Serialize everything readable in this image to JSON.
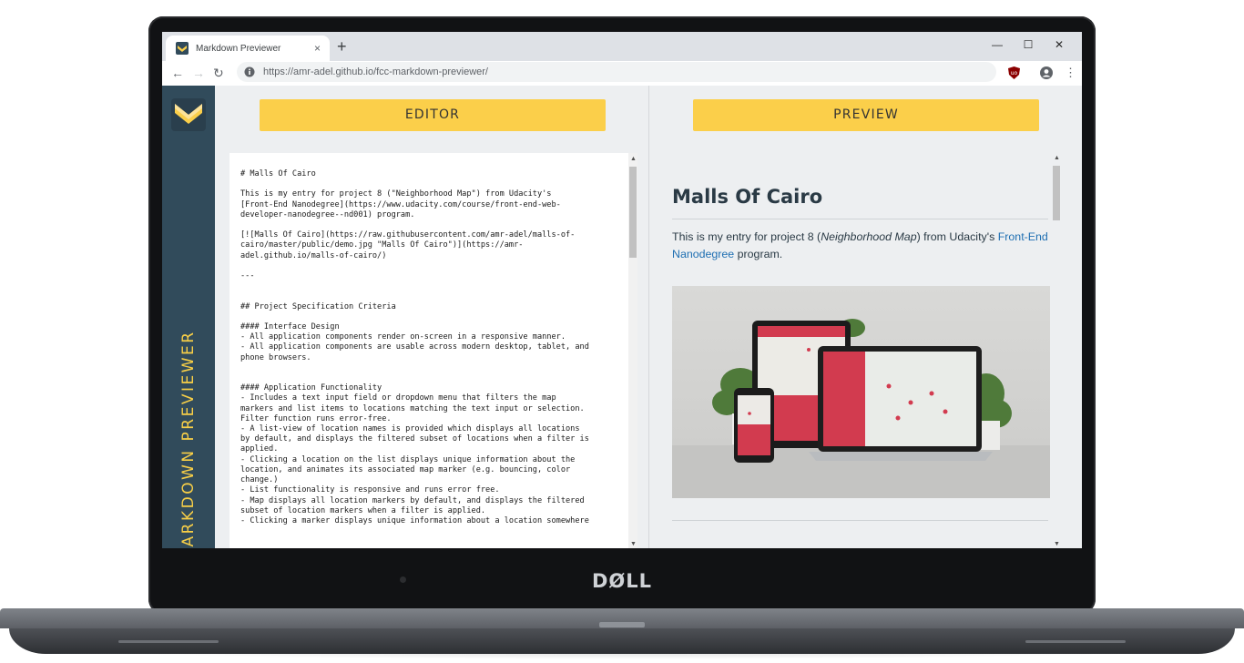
{
  "browser": {
    "tab_title": "Markdown Previewer",
    "tab_close": "×",
    "new_tab": "+",
    "url": "https://amr-adel.github.io/fcc-markdown-previewer/",
    "window_controls": {
      "minimize": "—",
      "maximize": "☐",
      "close": "✕"
    },
    "nav": {
      "back": "←",
      "forward": "→",
      "reload": "↻"
    },
    "menu": "⋮"
  },
  "device": {
    "brand": "DØLL"
  },
  "app": {
    "sidebar_title": "MARKDOWN PREVIEWER",
    "editor_button": "EDITOR",
    "preview_button": "PREVIEW",
    "accent_color": "#fbcf4a",
    "sidebar_color": "#314b5b",
    "editor_text": "# Malls Of Cairo\n\nThis is my entry for project 8 (\"Neighborhood Map\") from Udacity's\n[Front-End Nanodegree](https://www.udacity.com/course/front-end-web-\ndeveloper-nanodegree--nd001) program.\n\n[![Malls Of Cairo](https://raw.githubusercontent.com/amr-adel/malls-of-\ncairo/master/public/demo.jpg \"Malls Of Cairo\")](https://amr-\nadel.github.io/malls-of-cairo/)\n\n---\n\n\n## Project Specification Criteria\n\n#### Interface Design\n- All application components render on-screen in a responsive manner.\n- All application components are usable across modern desktop, tablet, and\nphone browsers.\n\n\n#### Application Functionality\n- Includes a text input field or dropdown menu that filters the map\nmarkers and list items to locations matching the text input or selection.\nFilter function runs error-free.\n- A list-view of location names is provided which displays all locations\nby default, and displays the filtered subset of locations when a filter is\napplied.\n- Clicking a location on the list displays unique information about the\nlocation, and animates its associated map marker (e.g. bouncing, color\nchange.)\n- List functionality is responsive and runs error free.\n- Map displays all location markers by default, and displays the filtered\nsubset of location markers when a filter is applied.\n- Clicking a marker displays unique information about a location somewhere",
    "preview": {
      "title": "Malls Of Cairo",
      "para_before": "This is my entry for project 8 (",
      "para_em": "Neighborhood Map",
      "para_mid": ") from Udacity's ",
      "para_link": "Front-End Nanodegree",
      "para_after": " program.",
      "image_alt": "Malls Of Cairo"
    }
  }
}
